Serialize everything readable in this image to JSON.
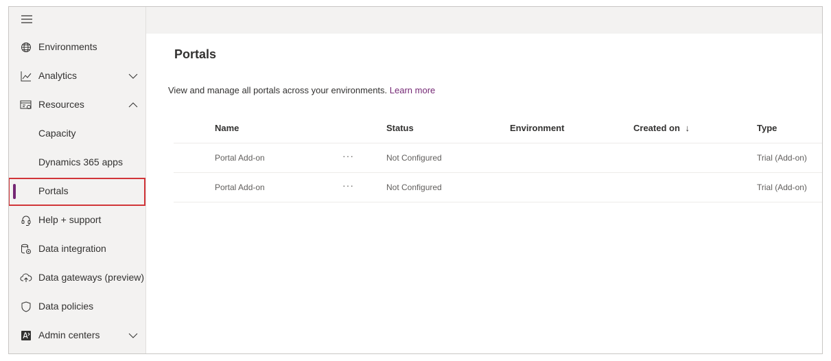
{
  "sidebar": {
    "items": [
      {
        "label": "Environments",
        "icon": "globe-icon"
      },
      {
        "label": "Analytics",
        "icon": "chart-line-icon",
        "chevron": "chevron-down-icon"
      },
      {
        "label": "Resources",
        "icon": "resources-icon",
        "chevron": "chevron-up-icon"
      },
      {
        "label": "Capacity"
      },
      {
        "label": "Dynamics 365 apps"
      },
      {
        "label": "Portals",
        "selected": true
      },
      {
        "label": "Help + support",
        "icon": "headset-icon"
      },
      {
        "label": "Data integration",
        "icon": "data-integration-icon"
      },
      {
        "label": "Data gateways (preview)",
        "icon": "cloud-upload-icon"
      },
      {
        "label": "Data policies",
        "icon": "shield-icon"
      },
      {
        "label": "Admin centers",
        "icon": "admin-centers-icon",
        "chevron": "chevron-down-icon"
      }
    ]
  },
  "page": {
    "title": "Portals",
    "description": "View and manage all portals across your environments.",
    "learn_more": "Learn more"
  },
  "table": {
    "columns": [
      "Name",
      "Status",
      "Environment",
      "Created on",
      "Type"
    ],
    "sort_indicator": "↓",
    "rows": [
      {
        "name": "Portal Add-on",
        "more": "···",
        "status": "Not Configured",
        "environment": "",
        "created_on": "",
        "type": "Trial (Add-on)"
      },
      {
        "name": "Portal Add-on",
        "more": "···",
        "status": "Not Configured",
        "environment": "",
        "created_on": "",
        "type": "Trial (Add-on)"
      }
    ]
  },
  "colors": {
    "accent": "#742774",
    "highlight": "#d13438",
    "sidebar_bg": "#f3f2f1"
  }
}
